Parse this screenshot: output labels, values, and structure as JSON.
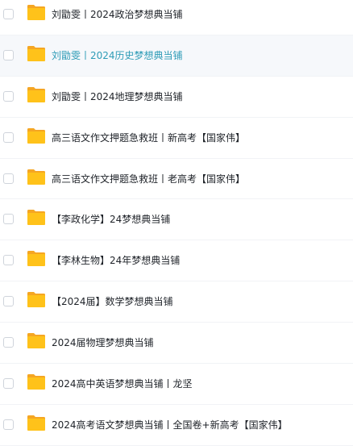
{
  "colors": {
    "folder": "#ffc21a",
    "folder_back": "#f5a623",
    "hover_text": "#2f9cb7",
    "text": "#1f2329"
  },
  "files": [
    {
      "name": "刘勖雯丨2024政治梦想典当铺",
      "icon": "folder-icon",
      "hovered": false
    },
    {
      "name": "刘勖雯丨2024历史梦想典当铺",
      "icon": "folder-icon",
      "hovered": true
    },
    {
      "name": "刘勖雯丨2024地理梦想典当铺",
      "icon": "folder-icon",
      "hovered": false
    },
    {
      "name": "高三语文作文押题急救班丨新高考【国家伟】",
      "icon": "folder-icon",
      "hovered": false
    },
    {
      "name": "高三语文作文押题急救班丨老高考【国家伟】",
      "icon": "folder-icon",
      "hovered": false
    },
    {
      "name": "【李政化学】24梦想典当铺",
      "icon": "folder-icon",
      "hovered": false
    },
    {
      "name": "【李林生物】24年梦想典当铺",
      "icon": "folder-icon",
      "hovered": false
    },
    {
      "name": "【2024届】数学梦想典当铺",
      "icon": "folder-icon",
      "hovered": false
    },
    {
      "name": "2024届物理梦想典当铺",
      "icon": "folder-icon",
      "hovered": false
    },
    {
      "name": "2024高中英语梦想典当铺丨龙坚",
      "icon": "folder-icon",
      "hovered": false
    },
    {
      "name": "2024高考语文梦想典当铺丨全国卷+新高考【国家伟】",
      "icon": "folder-icon",
      "hovered": false
    }
  ]
}
